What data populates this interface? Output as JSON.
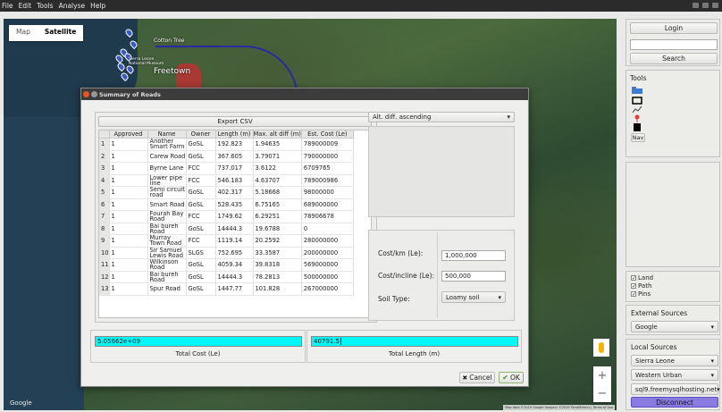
{
  "menubar": {
    "items": [
      "File",
      "Edit",
      "Tools",
      "Analyse",
      "Help"
    ]
  },
  "map": {
    "tabs": [
      "Map",
      "Satellite"
    ],
    "active_tab": "Satellite",
    "labels": {
      "cotton_tree": "Cotton Tree",
      "town": "Freetown",
      "museum": "Sierra Leone National Museum"
    },
    "google": "Google",
    "attribution": "Map data ©2019 Google Imagery ©2019 TerraMetrics | Terms of Use"
  },
  "dialog": {
    "title": "Summary of Roads",
    "export_label": "Export CSV",
    "columns": [
      "",
      "Approved",
      "Name",
      "Owner",
      "Length (m)",
      "Max. alt diff (m)",
      "Est. Cost (Le)"
    ],
    "rows": [
      [
        "1",
        "1",
        "Another Smart Farm",
        "GoSL",
        "192.823",
        "1.94635",
        "789000009"
      ],
      [
        "2",
        "1",
        "Carew Road",
        "GoSL",
        "367.605",
        "3.79071",
        "790000000"
      ],
      [
        "3",
        "1",
        "Byrne Lane",
        "FCC",
        "737.017",
        "3.6122",
        "6709765"
      ],
      [
        "4",
        "1",
        "Lower pipe line",
        "FCC",
        "546.183",
        "4.63707",
        "789000986"
      ],
      [
        "5",
        "1",
        "Semi circuit road",
        "GoSL",
        "402.317",
        "5.18668",
        "98000000"
      ],
      [
        "6",
        "1",
        "Smart Road",
        "GoSL",
        "528.435",
        "6.75165",
        "689000000"
      ],
      [
        "7",
        "1",
        "Fourah Bay Road",
        "FCC",
        "1749.62",
        "6.29251",
        "78906678"
      ],
      [
        "8",
        "1",
        "Bai bureh Road",
        "GoSL",
        "14444.3",
        "19.6788",
        "0"
      ],
      [
        "9",
        "1",
        "Murray Town Road",
        "FCC",
        "1119.14",
        "20.2592",
        "280000000"
      ],
      [
        "10",
        "1",
        "Sir Samuel Lewis Road",
        "SLGS",
        "752.695",
        "33.3587",
        "200000000"
      ],
      [
        "11",
        "1",
        "Wilkinson Road",
        "GoSL",
        "4059.34",
        "39.8318",
        "569000000"
      ],
      [
        "12",
        "1",
        "Bai bureh Road",
        "GoSL",
        "14444.3",
        "78.2813",
        "500000000"
      ],
      [
        "13",
        "1",
        "Spur Road",
        "GoSL",
        "1447.77",
        "101.828",
        "267000000"
      ]
    ],
    "sort_label": "Alt. diff. ascending",
    "cost_km_label": "Cost/km (Le):",
    "cost_km_value": "1,000,000",
    "cost_incline_label": "Cost/incline (Le):",
    "cost_incline_value": "500,000",
    "soil_label": "Soil Type:",
    "soil_value": "Loamy soil",
    "total_cost_value": "5.05662e+09",
    "total_cost_label": "Total Cost (Le)",
    "total_length_value": "40791.5",
    "total_length_label": "Total Length (m)",
    "cancel_label": "Cancel",
    "ok_label": "OK"
  },
  "sidebar": {
    "login_label": "Login",
    "search_label": "Search",
    "tools_title": "Tools",
    "nav_label": "Nav",
    "layers": [
      "Land",
      "Path",
      "Pins"
    ],
    "external_title": "External Sources",
    "external_value": "Google",
    "local_title": "Local Sources",
    "local_values": [
      "Sierra Leone",
      "Western Urban",
      "sql9.freemysqlhosting.net"
    ],
    "disconnect_label": "Disconnect"
  },
  "colors": {
    "accent_cyan": "#00f7f7",
    "disconnect": "#8a7be3",
    "menubar": "#2b2b2b"
  }
}
